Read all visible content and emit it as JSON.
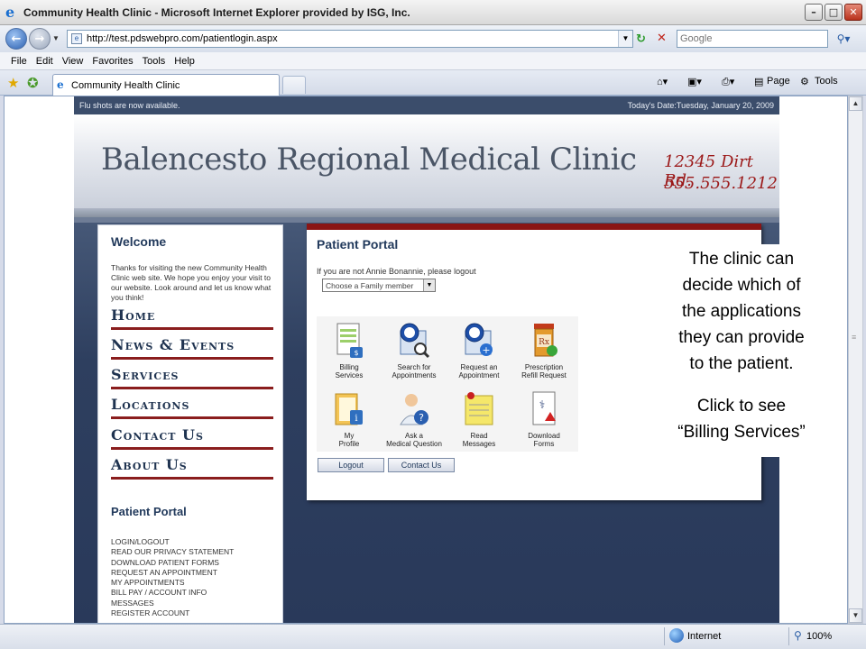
{
  "window": {
    "title": "Community Health Clinic - Microsoft Internet Explorer provided by ISG, Inc.",
    "min_label": "–",
    "max_label": "□",
    "close_label": "✕"
  },
  "nav": {
    "url": "http://test.pdswebpro.com/patientlogin.aspx",
    "search_placeholder": "Google"
  },
  "menu": [
    "File",
    "Edit",
    "View",
    "Favorites",
    "Tools",
    "Help"
  ],
  "tab": {
    "label": "Community Health Clinic"
  },
  "commands": {
    "page": "Page",
    "tools": "Tools"
  },
  "site": {
    "flu_notice": "Flu shots are now available.",
    "date_line": "Today's Date:Tuesday, January 20, 2009",
    "clinic_name": "Balencesto Regional Medical Clinic",
    "address": "12345 Dirt Rd.",
    "phone": "555.555.1212",
    "welcome": {
      "title": "Welcome",
      "text": "Thanks for visiting the new Community Health Clinic web site. We hope you enjoy your visit to our website. Look around and let us know what you think!"
    },
    "nav_links": [
      "Home",
      "News & Events",
      "Services",
      "Locations",
      "Contact Us",
      "About Us"
    ],
    "patient_portal_links": {
      "title": "Patient Portal",
      "items": [
        "LOGIN/LOGOUT",
        "READ OUR PRIVACY STATEMENT",
        "DOWNLOAD PATIENT FORMS",
        "REQUEST AN APPOINTMENT",
        "MY APPOINTMENTS",
        "BILL PAY / ACCOUNT INFO",
        "MESSAGES",
        "REGISTER ACCOUNT"
      ]
    }
  },
  "portal": {
    "title": "Patient Portal",
    "logout_note": "If you are not Annie Bonannie, please logout",
    "family_select": "Choose a Family member",
    "apps": [
      {
        "label1": "Billing",
        "label2": "Services"
      },
      {
        "label1": "Search for",
        "label2": "Appointments"
      },
      {
        "label1": "Request an",
        "label2": "Appointment"
      },
      {
        "label1": "Prescription",
        "label2": "Refill Request"
      },
      {
        "label1": "My",
        "label2": "Profile"
      },
      {
        "label1": "Ask a",
        "label2": "Medical Question"
      },
      {
        "label1": "Read",
        "label2": "Messages"
      },
      {
        "label1": "Download",
        "label2": "Forms"
      }
    ],
    "logout_button": "Logout",
    "contact_button": "Contact Us"
  },
  "callout": {
    "line1": "The clinic can",
    "line2": "decide which of",
    "line3": "the applications",
    "line4": "they can provide",
    "line5": "to the patient.",
    "line6": "Click to see",
    "line7": "“Billing Services”"
  },
  "status": {
    "zone": "Internet",
    "zoom": "100%"
  }
}
